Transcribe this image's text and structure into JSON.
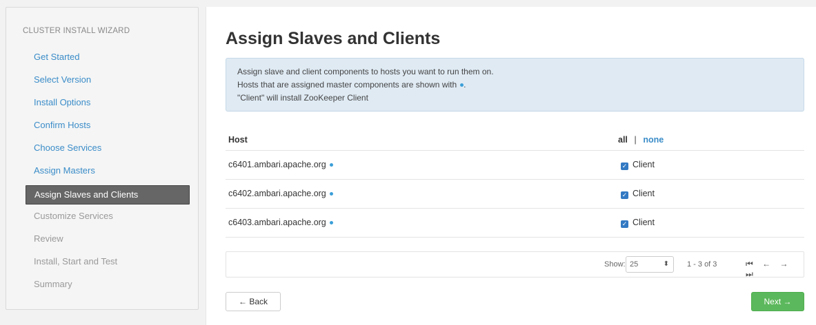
{
  "sidebar": {
    "title": "CLUSTER INSTALL WIZARD",
    "steps": [
      {
        "label": "Get Started",
        "state": "done"
      },
      {
        "label": "Select Version",
        "state": "done"
      },
      {
        "label": "Install Options",
        "state": "done"
      },
      {
        "label": "Confirm Hosts",
        "state": "done"
      },
      {
        "label": "Choose Services",
        "state": "done"
      },
      {
        "label": "Assign Masters",
        "state": "done"
      },
      {
        "label": "Assign Slaves and Clients",
        "state": "active"
      },
      {
        "label": "Customize Services",
        "state": "todo"
      },
      {
        "label": "Review",
        "state": "todo"
      },
      {
        "label": "Install, Start and Test",
        "state": "todo"
      },
      {
        "label": "Summary",
        "state": "todo"
      }
    ]
  },
  "main": {
    "title": "Assign Slaves and Clients",
    "info": {
      "line1": "Assign slave and client components to hosts you want to run them on.",
      "line2": "Hosts that are assigned master components are shown with",
      "line3": "\"Client\" will install ZooKeeper Client"
    },
    "table": {
      "host_header": "Host",
      "all_label": "all",
      "separator": "|",
      "none_label": "none",
      "rows": [
        {
          "host": "c6401.ambari.apache.org",
          "component": "Client",
          "checked": true
        },
        {
          "host": "c6402.ambari.apache.org",
          "component": "Client",
          "checked": true
        },
        {
          "host": "c6403.ambari.apache.org",
          "component": "Client",
          "checked": true
        }
      ]
    },
    "pagination": {
      "show_label": "Show:",
      "page_size": "25",
      "range": "1 - 3 of 3",
      "first": "⏮",
      "prev": "←",
      "next": "→",
      "last": "⏭"
    },
    "buttons": {
      "back": "← Back",
      "next": "Next →"
    }
  },
  "colors": {
    "link": "#3a8cc8",
    "active_step_bg": "#666666",
    "info_bg": "#dfeaf3",
    "next_button": "#5cb85c",
    "checkbox": "#3279c3"
  }
}
